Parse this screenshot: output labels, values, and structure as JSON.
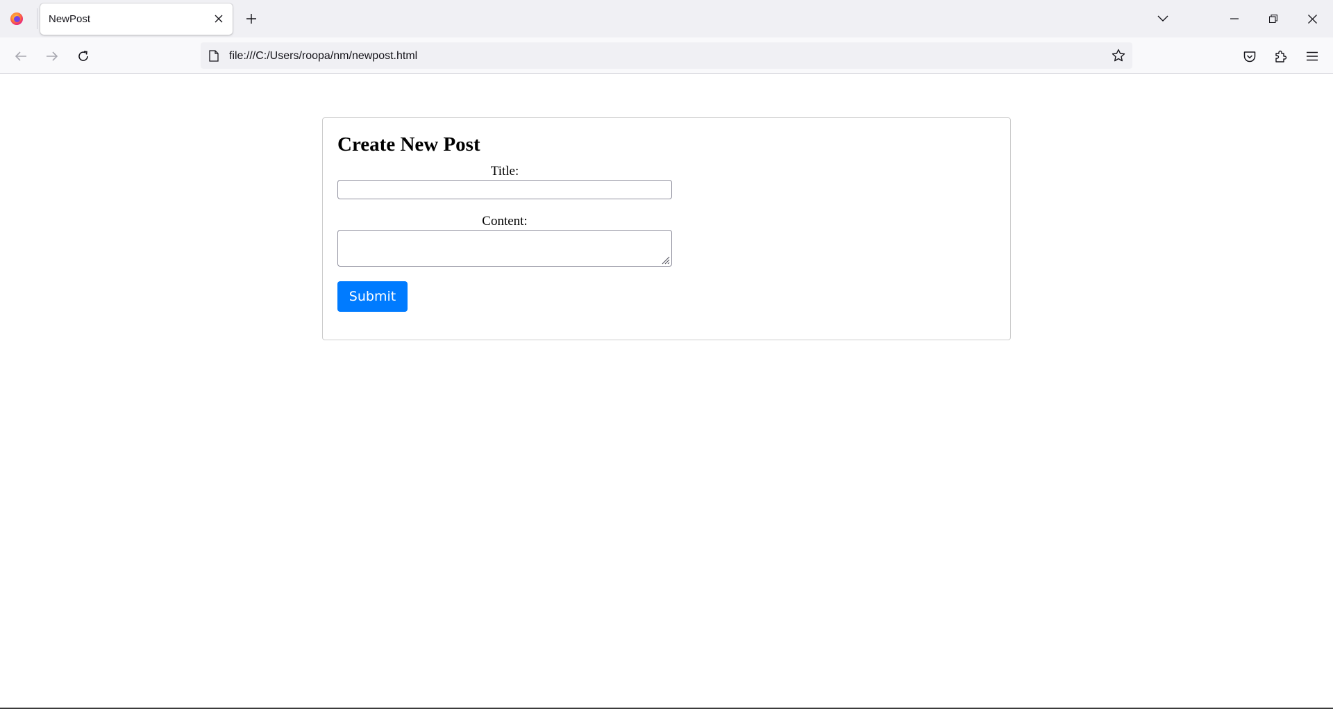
{
  "browser": {
    "tab_title": "NewPost",
    "url": "file:///C:/Users/roopa/nm/newpost.html",
    "icons": {
      "logo": "firefox-logo-icon",
      "tab_close": "close-icon",
      "new_tab": "plus-icon",
      "tab_list": "chevron-down-icon",
      "minimize": "minimize-icon",
      "restore": "restore-icon",
      "close_window": "close-icon",
      "back": "arrow-left-icon",
      "forward": "arrow-right-icon",
      "reload": "reload-icon",
      "page": "page-icon",
      "bookmark": "star-icon",
      "pocket": "pocket-icon",
      "extensions": "puzzle-icon",
      "menu": "hamburger-menu-icon"
    }
  },
  "form": {
    "heading": "Create New Post",
    "title_label": "Title:",
    "title_value": "",
    "content_label": "Content:",
    "content_value": "",
    "submit_label": "Submit"
  },
  "colors": {
    "submit_bg": "#007bff",
    "tabstrip_bg": "#f0f0f4",
    "navbar_bg": "#f9f9fb"
  }
}
